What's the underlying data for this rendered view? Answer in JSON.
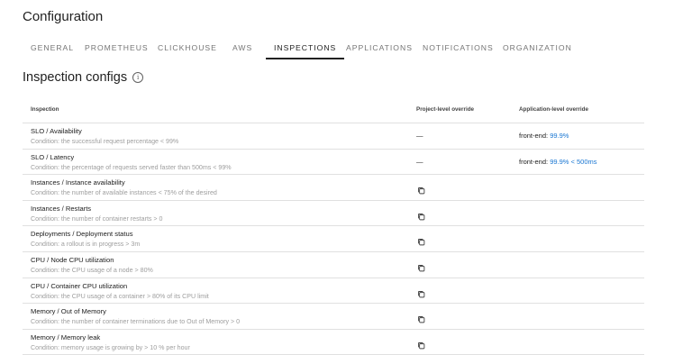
{
  "page": {
    "title": "Configuration"
  },
  "tabs": [
    {
      "label": "GENERAL",
      "active": false
    },
    {
      "label": "PROMETHEUS",
      "active": false
    },
    {
      "label": "CLICKHOUSE",
      "active": false
    },
    {
      "label": "AWS",
      "active": false
    },
    {
      "label": "INSPECTIONS",
      "active": true
    },
    {
      "label": "APPLICATIONS",
      "active": false
    },
    {
      "label": "NOTIFICATIONS",
      "active": false
    },
    {
      "label": "ORGANIZATION",
      "active": false
    }
  ],
  "section": {
    "title": "Inspection configs",
    "info_icon": "info-icon"
  },
  "table": {
    "headers": {
      "inspection": "Inspection",
      "project": "Project-level override",
      "application": "Application-level override"
    },
    "rows": [
      {
        "name": "SLO / Availability",
        "condition": "Condition: the successful request percentage < 99%",
        "project": "—",
        "app_prefix": "front-end: ",
        "app_value": "99.9%",
        "project_icon": ""
      },
      {
        "name": "SLO / Latency",
        "condition": "Condition: the percentage of requests served faster than 500ms < 99%",
        "project": "—",
        "app_prefix": "front-end: ",
        "app_value": "99.9% < 500ms",
        "project_icon": ""
      },
      {
        "name": "Instances / Instance availability",
        "condition": "Condition: the number of available instances < 75% of the desired",
        "project": "",
        "app_prefix": "",
        "app_value": "",
        "project_icon": "copy-icon"
      },
      {
        "name": "Instances / Restarts",
        "condition": "Condition: the number of container restarts > 0",
        "project": "",
        "app_prefix": "",
        "app_value": "",
        "project_icon": "copy-icon"
      },
      {
        "name": "Deployments / Deployment status",
        "condition": "Condition: a rollout is in progress > 3m",
        "project": "",
        "app_prefix": "",
        "app_value": "",
        "project_icon": "copy-icon"
      },
      {
        "name": "CPU / Node CPU utilization",
        "condition": "Condition: the CPU usage of a node > 80%",
        "project": "",
        "app_prefix": "",
        "app_value": "",
        "project_icon": "copy-icon"
      },
      {
        "name": "CPU / Container CPU utilization",
        "condition": "Condition: the CPU usage of a container > 80% of its CPU limit",
        "project": "",
        "app_prefix": "",
        "app_value": "",
        "project_icon": "copy-icon"
      },
      {
        "name": "Memory / Out of Memory",
        "condition": "Condition: the number of container terminations due to Out of Memory > 0",
        "project": "",
        "app_prefix": "",
        "app_value": "",
        "project_icon": "copy-icon"
      },
      {
        "name": "Memory / Memory leak",
        "condition": "Condition: memory usage is growing by > 10 % per hour",
        "project": "",
        "app_prefix": "",
        "app_value": "",
        "project_icon": "copy-icon"
      }
    ]
  }
}
